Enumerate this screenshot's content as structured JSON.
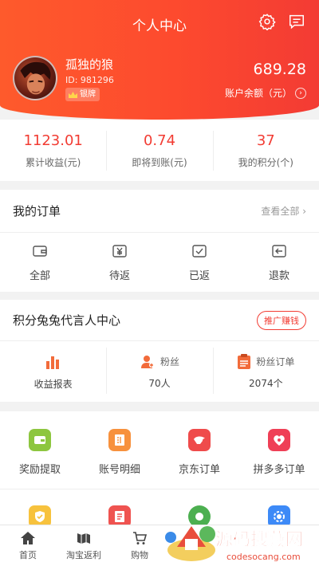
{
  "header": {
    "title": "个人中心",
    "colors": {
      "start": "#fe5a2c",
      "end": "#f33b34"
    }
  },
  "user": {
    "name": "孤独的狼",
    "id": "ID: 981296",
    "level": "银牌"
  },
  "balance": {
    "amount": "689.28",
    "label": "账户余额（元）"
  },
  "stats": [
    {
      "value": "1123.01",
      "label": "累计收益(元)"
    },
    {
      "value": "0.74",
      "label": "即将到账(元)"
    },
    {
      "value": "37",
      "label": "我的积分(个)"
    }
  ],
  "orders": {
    "title": "我的订单",
    "view_all": "查看全部",
    "items": [
      {
        "label": "全部",
        "icon": "wallet-icon"
      },
      {
        "label": "待返",
        "icon": "yen-card-icon"
      },
      {
        "label": "已返",
        "icon": "check-card-icon"
      },
      {
        "label": "退款",
        "icon": "refund-icon"
      }
    ]
  },
  "promoter": {
    "title": "积分兔兔代言人中心",
    "button": "推广赚钱",
    "items": [
      {
        "top": "",
        "bottom": "收益报表",
        "icon": "bar-chart-icon"
      },
      {
        "top": "粉丝",
        "bottom": "70人",
        "icon": "fans-icon"
      },
      {
        "top": "粉丝订单",
        "bottom": "2074个",
        "icon": "fan-orders-icon"
      }
    ]
  },
  "tools": {
    "items": [
      {
        "label": "奖励提取",
        "icon": "reward-wallet-icon",
        "color": "#8dc63f"
      },
      {
        "label": "账号明细",
        "icon": "account-detail-icon",
        "color": "#f7913d"
      },
      {
        "label": "京东订单",
        "icon": "jd-icon",
        "color": "#ef4b4b"
      },
      {
        "label": "拼多多订单",
        "icon": "pinduoduo-icon",
        "color": "#ef3f56"
      }
    ],
    "row2_icons": [
      {
        "icon": "shield-check-icon",
        "color": "#f7c23d"
      },
      {
        "icon": "document-icon",
        "color": "#ef5350"
      },
      {
        "icon": "green-circle-icon",
        "color": "#4caf50"
      },
      {
        "icon": "blue-gear-icon",
        "color": "#3d8af7"
      }
    ]
  },
  "bottom_nav": [
    {
      "label": "首页",
      "icon": "home-icon"
    },
    {
      "label": "淘宝返利",
      "icon": "taobao-icon"
    },
    {
      "label": "购物",
      "icon": "cart-icon"
    }
  ],
  "watermark": {
    "text": "源码搜藏网",
    "url": "codesocang.com"
  }
}
